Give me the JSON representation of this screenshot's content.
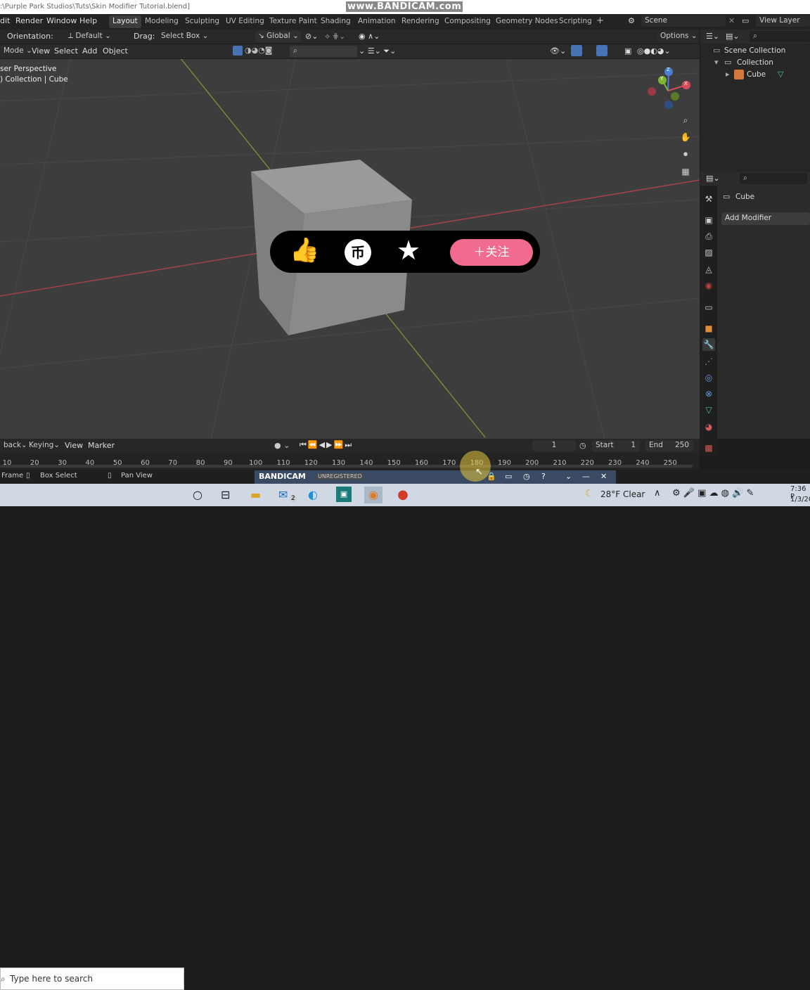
{
  "title_bar": {
    "path": ":\\Purple Park Studios\\Tuts\\Skin Modifier Tutorial.blend]",
    "watermark": "www.BANDICAM.com"
  },
  "menu": [
    "dit",
    "Render",
    "Window",
    "Help"
  ],
  "workspaces": [
    "Layout",
    "Modeling",
    "Sculpting",
    "UV Editing",
    "Texture Paint",
    "Shading",
    "Animation",
    "Rendering",
    "Compositing",
    "Geometry Nodes",
    "Scripting",
    "+"
  ],
  "scene": {
    "label": "Scene",
    "view_layer": "View Layer"
  },
  "tool_header": {
    "orientation_label": "Orientation:",
    "orientation_value": "Default",
    "drag_label": "Drag:",
    "drag_value": "Select Box",
    "transform": "Global",
    "options": "Options"
  },
  "viewport_header": {
    "mode": "Mode",
    "items": [
      "View",
      "Select",
      "Add",
      "Object"
    ]
  },
  "viewport_info": {
    "line1": "ser Perspective",
    "line2": ") Collection | Cube"
  },
  "gizmo": {
    "x": "X",
    "y": "Y",
    "z": "Z"
  },
  "outliner": {
    "scene_collection": "Scene Collection",
    "collection": "Collection",
    "cube": "Cube"
  },
  "properties": {
    "object_name": "Cube",
    "add_modifier": "Add Modifier"
  },
  "timeline": {
    "playback": "back",
    "keying": "Keying",
    "view": "View",
    "marker": "Marker",
    "current_frame": "1",
    "start_label": "Start",
    "start": "1",
    "end_label": "End",
    "end": "250"
  },
  "ruler_ticks": [
    "10",
    "20",
    "30",
    "40",
    "50",
    "60",
    "70",
    "80",
    "90",
    "100",
    "110",
    "120",
    "130",
    "140",
    "150",
    "160",
    "170",
    "180",
    "190",
    "200",
    "210",
    "220",
    "230",
    "240",
    "250"
  ],
  "statusbar": {
    "frame": "Frame",
    "box_select": "Box Select",
    "pan_view": "Pan View"
  },
  "bandicam": {
    "brand": "BANDICAM",
    "unregistered": "UNREGISTERED"
  },
  "overlay": {
    "follow": "＋关注"
  },
  "taskbar": {
    "search_placeholder": "Type here to search",
    "weather": "28°F  Clear",
    "time": "7:36 P",
    "date": "1/3/20",
    "mail_badge": "2"
  }
}
